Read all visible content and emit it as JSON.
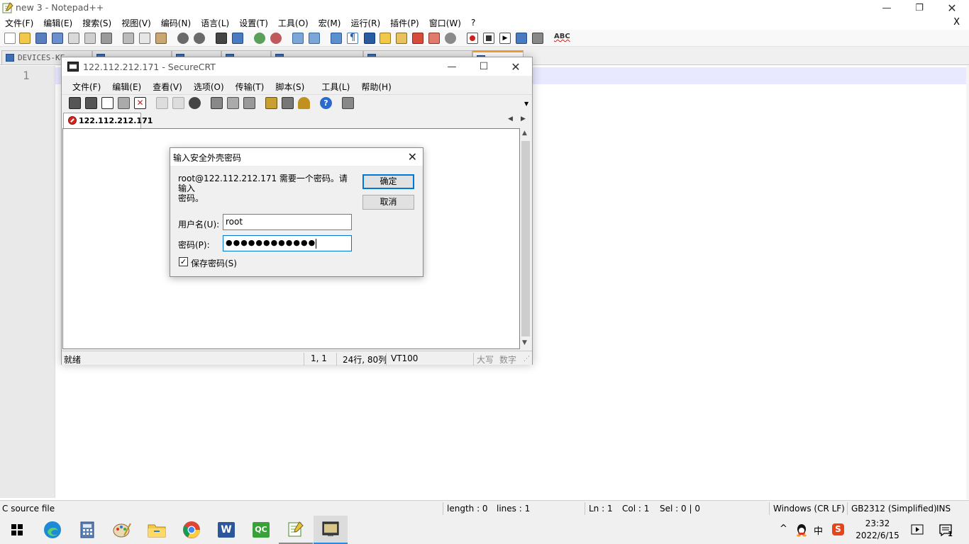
{
  "notepad": {
    "title": "new 3 - Notepad++",
    "menu": [
      "文件(F)",
      "编辑(E)",
      "搜索(S)",
      "视图(V)",
      "编码(N)",
      "语言(L)",
      "设置(T)",
      "工具(O)",
      "宏(M)",
      "运行(R)",
      "插件(P)",
      "窗口(W)",
      "?"
    ],
    "close_doc": "X",
    "first_tab": "DEVICES-KE",
    "line_number": "1",
    "toolbar_spellcheck": "ABC",
    "status": {
      "file_type": "C source file",
      "length": "length : 0",
      "lines": "lines : 1",
      "ln": "Ln : 1",
      "col": "Col : 1",
      "sel": "Sel : 0 | 0",
      "eol": "Windows (CR LF)",
      "encoding": "GB2312 (Simplified)",
      "mode": "INS"
    }
  },
  "securecrt": {
    "title": "122.112.212.171 - SecureCRT",
    "menu": [
      "文件(F)",
      "编辑(E)",
      "查看(V)",
      "选项(O)",
      "传输(T)",
      "脚本(S)",
      "工具(L)",
      "帮助(H)"
    ],
    "tab_label": "122.112.212.171",
    "status": {
      "ready": "就绪",
      "pos": "1,   1",
      "size": "24行, 80列",
      "term": "VT100",
      "caps": "大写",
      "num": "数字"
    }
  },
  "dialog": {
    "title": "输入安全外壳密码",
    "message_line1": "root@122.112.212.171 需要一个密码。请输入",
    "message_line2": "密码。",
    "ok": "确定",
    "cancel": "取消",
    "username_label": "用户名(U):",
    "username_value": "root",
    "password_label": "密码(P):",
    "password_mask": "●●●●●●●●●●●●",
    "save_password_label": "保存密码(S)",
    "save_password_checked": "✓"
  },
  "taskbar": {
    "apps": [
      "start-icon",
      "edge-icon",
      "calculator-icon",
      "paint-icon",
      "file-explorer-icon",
      "chrome-icon",
      "word-icon",
      "qc-icon",
      "notepadpp-icon",
      "securecrt-icon"
    ],
    "word_letter": "W",
    "qc_label": "QC",
    "tray": {
      "chevron": "^",
      "ime": "中",
      "sogou": "S",
      "notification_count": "1"
    },
    "time": "23:32",
    "date": "2022/6/15"
  }
}
